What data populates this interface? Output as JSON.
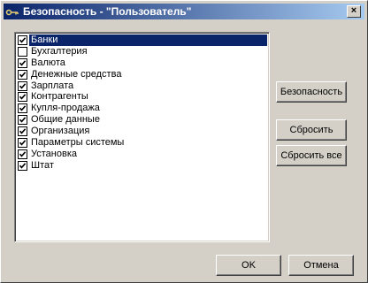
{
  "window": {
    "title": "Безопасность -  \"Пользователь\"",
    "close_label": "×"
  },
  "list": {
    "items": [
      {
        "label": "Банки",
        "checked": true,
        "selected": true
      },
      {
        "label": "Бухгалтерия",
        "checked": false,
        "selected": false
      },
      {
        "label": "Валюта",
        "checked": true,
        "selected": false
      },
      {
        "label": "Денежные средства",
        "checked": true,
        "selected": false
      },
      {
        "label": "Зарплата",
        "checked": true,
        "selected": false
      },
      {
        "label": "Контрагенты",
        "checked": true,
        "selected": false
      },
      {
        "label": "Купля-продажа",
        "checked": true,
        "selected": false
      },
      {
        "label": "Общие данные",
        "checked": true,
        "selected": false
      },
      {
        "label": "Организация",
        "checked": true,
        "selected": false
      },
      {
        "label": "Параметры системы",
        "checked": true,
        "selected": false
      },
      {
        "label": "Установка",
        "checked": true,
        "selected": false
      },
      {
        "label": "Штат",
        "checked": true,
        "selected": false
      }
    ]
  },
  "buttons": {
    "security": "Безопасность",
    "reset": "Сбросить",
    "reset_all": "Сбросить все",
    "ok": "OK",
    "cancel": "Отмена"
  }
}
